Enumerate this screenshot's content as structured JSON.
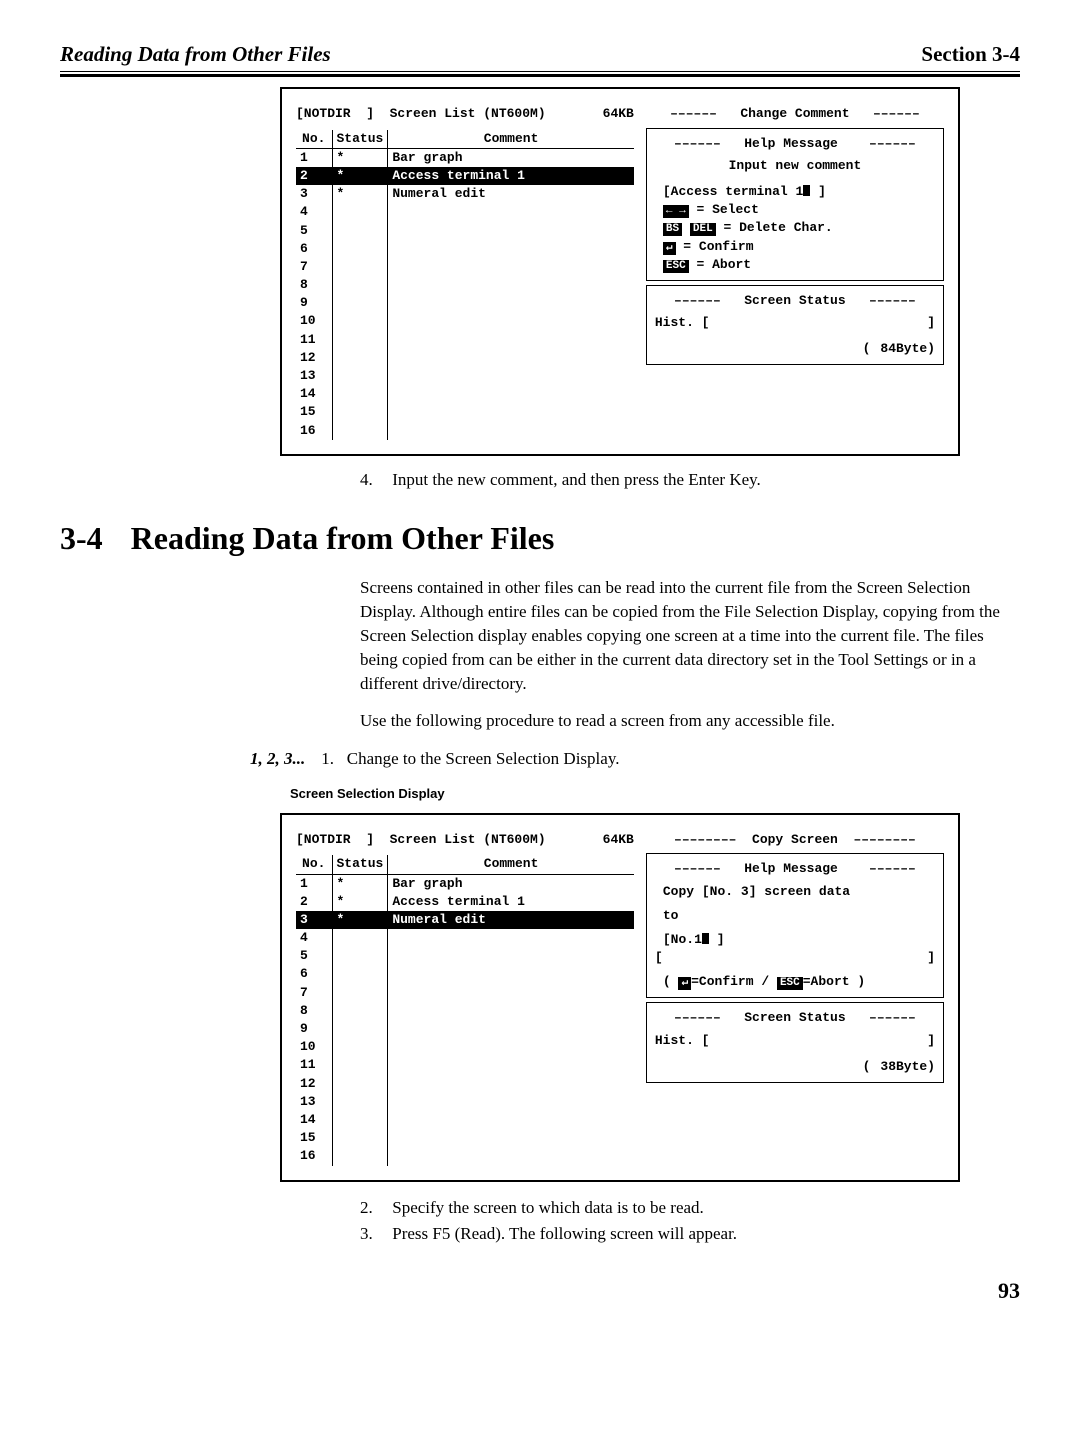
{
  "header": {
    "left": "Reading Data from Other Files",
    "right": "Section 3-4"
  },
  "fig1": {
    "title_left": "[NOTDIR  ]  Screen List (NT600M)",
    "title_right": "64KB",
    "right_title": "––––––   Change Comment   ––––––",
    "table": {
      "headers": {
        "no": "No.",
        "status": "Status",
        "comment": "Comment"
      },
      "rows": [
        {
          "no": "1",
          "status": "*",
          "comment": "Bar graph",
          "hl": false
        },
        {
          "no": "2",
          "status": "*",
          "comment": "Access terminal 1",
          "hl": true
        },
        {
          "no": "3",
          "status": "*",
          "comment": "Numeral edit",
          "hl": false
        },
        {
          "no": "4",
          "status": "",
          "comment": "",
          "hl": false
        },
        {
          "no": "5",
          "status": "",
          "comment": "",
          "hl": false
        },
        {
          "no": "6",
          "status": "",
          "comment": "",
          "hl": false
        },
        {
          "no": "7",
          "status": "",
          "comment": "",
          "hl": false
        },
        {
          "no": "8",
          "status": "",
          "comment": "",
          "hl": false
        },
        {
          "no": "9",
          "status": "",
          "comment": "",
          "hl": false
        },
        {
          "no": "10",
          "status": "",
          "comment": "",
          "hl": false
        },
        {
          "no": "11",
          "status": "",
          "comment": "",
          "hl": false
        },
        {
          "no": "12",
          "status": "",
          "comment": "",
          "hl": false
        },
        {
          "no": "13",
          "status": "",
          "comment": "",
          "hl": false
        },
        {
          "no": "14",
          "status": "",
          "comment": "",
          "hl": false
        },
        {
          "no": "15",
          "status": "",
          "comment": "",
          "hl": false
        },
        {
          "no": "16",
          "status": "",
          "comment": "",
          "hl": false
        }
      ]
    },
    "help": {
      "title": "––––––   Help Message    ––––––",
      "l1": "Input new comment",
      "l2_pre": "[Access terminal 1",
      "l2_post": "    ]",
      "k_arrows": "← →",
      "k_arrows_label": "   = Select",
      "k_bs": "BS",
      "k_del": "DEL",
      "k_delete_label": " = Delete Char.",
      "k_enter": "↵",
      "k_confirm_label": "     = Confirm",
      "k_esc": "ESC",
      "k_abort_label": "    = Abort"
    },
    "status": {
      "title": "––––––   Screen Status   ––––––",
      "hist": "Hist. [",
      "hist_close": "]",
      "open": "(",
      "bytes": "84Byte)"
    }
  },
  "step4": {
    "num": "4.",
    "text": "Input the new comment, and then press the Enter Key."
  },
  "section": {
    "num": "3-4",
    "title": "Reading Data from Other Files",
    "p1": "Screens contained in other files can be read into the current file from the Screen Selection Display. Although entire files can be copied from the File Selection Display, copying from the Screen Selection display enables copy­ing one screen at a time into the current file. The files being copied from can be either in the current data directory set in the Tool Settings or in a different drive/directory.",
    "p2": "Use the following procedure to read a screen from any accessible file.",
    "steps_label": "1, 2, 3...",
    "step1_num": "1.",
    "step1_text": "Change to the Screen Selection Display.",
    "caption": "Screen Selection Display"
  },
  "fig2": {
    "title_left": "[NOTDIR  ]  Screen List (NT600M)",
    "title_right": "64KB",
    "right_title": "––––––––  Copy Screen  ––––––––",
    "table": {
      "headers": {
        "no": "No.",
        "status": "Status",
        "comment": "Comment"
      },
      "rows": [
        {
          "no": "1",
          "status": "*",
          "comment": "Bar graph",
          "hl": false
        },
        {
          "no": "2",
          "status": "*",
          "comment": "Access terminal 1",
          "hl": false
        },
        {
          "no": "3",
          "status": "*",
          "comment": "Numeral edit",
          "hl": true
        },
        {
          "no": "4",
          "status": "",
          "comment": "",
          "hl": false
        },
        {
          "no": "5",
          "status": "",
          "comment": "",
          "hl": false
        },
        {
          "no": "6",
          "status": "",
          "comment": "",
          "hl": false
        },
        {
          "no": "7",
          "status": "",
          "comment": "",
          "hl": false
        },
        {
          "no": "8",
          "status": "",
          "comment": "",
          "hl": false
        },
        {
          "no": "9",
          "status": "",
          "comment": "",
          "hl": false
        },
        {
          "no": "10",
          "status": "",
          "comment": "",
          "hl": false
        },
        {
          "no": "11",
          "status": "",
          "comment": "",
          "hl": false
        },
        {
          "no": "12",
          "status": "",
          "comment": "",
          "hl": false
        },
        {
          "no": "13",
          "status": "",
          "comment": "",
          "hl": false
        },
        {
          "no": "14",
          "status": "",
          "comment": "",
          "hl": false
        },
        {
          "no": "15",
          "status": "",
          "comment": "",
          "hl": false
        },
        {
          "no": "16",
          "status": "",
          "comment": "",
          "hl": false
        }
      ]
    },
    "help": {
      "title": "––––––   Help Message    ––––––",
      "l1": "Copy [No.   3] screen data",
      "l2": "to",
      "l3_pre": "[No.1",
      "l3_post": "  ]",
      "l4_open": "[",
      "l4_close": "]",
      "l5_open": "( ",
      "k_enter": "↵",
      "l5_mid1": "=Confirm / ",
      "k_esc": "ESC",
      "l5_mid2": "=Abort )"
    },
    "status": {
      "title": "––––––   Screen Status   ––––––",
      "hist": "Hist. [",
      "hist_close": "]",
      "open": "(",
      "bytes": "38Byte)"
    }
  },
  "end_steps": {
    "s2_num": "2.",
    "s2_text": "Specify the screen to which data is to be read.",
    "s3_num": "3.",
    "s3_text": "Press F5 (Read). The following screen will appear."
  },
  "page_number": "93"
}
